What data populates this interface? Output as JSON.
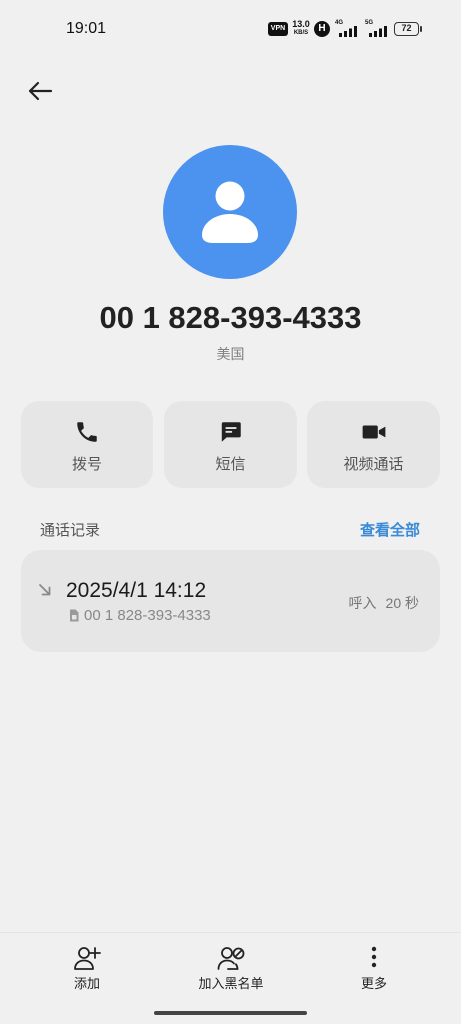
{
  "status_bar": {
    "time": "19:01",
    "vpn": "VPN",
    "speed_value": "13.0",
    "speed_unit": "KB/S",
    "hd": "H",
    "network_1": "4G",
    "network_2": "5G",
    "battery": "72"
  },
  "header": {
    "back_icon": "back-arrow-icon"
  },
  "contact": {
    "avatar_icon": "person-icon",
    "number": "00 1 828-393-4333",
    "region": "美国"
  },
  "actions": [
    {
      "label": "拨号",
      "icon": "phone-icon"
    },
    {
      "label": "短信",
      "icon": "message-icon"
    },
    {
      "label": "视频通话",
      "icon": "video-camera-icon"
    }
  ],
  "call_log": {
    "title": "通话记录",
    "view_all": "查看全部",
    "records": [
      {
        "direction_icon": "incoming-call-arrow-icon",
        "datetime": "2025/4/1 14:12",
        "sim_icon": "sim-card-icon",
        "number": "00 1 828-393-4333",
        "type": "呼入",
        "duration": "20 秒"
      }
    ]
  },
  "bottom_bar": [
    {
      "label": "添加",
      "icon": "add-contact-icon"
    },
    {
      "label": "加入黑名单",
      "icon": "block-contact-icon"
    },
    {
      "label": "更多",
      "icon": "more-vertical-icon"
    }
  ],
  "colors": {
    "background": "#f0f0f0",
    "card": "#e6e6e6",
    "avatar": "#4b93ef",
    "accent": "#3a8ad6",
    "text_primary": "#1a1a1a",
    "text_secondary": "#808080"
  }
}
